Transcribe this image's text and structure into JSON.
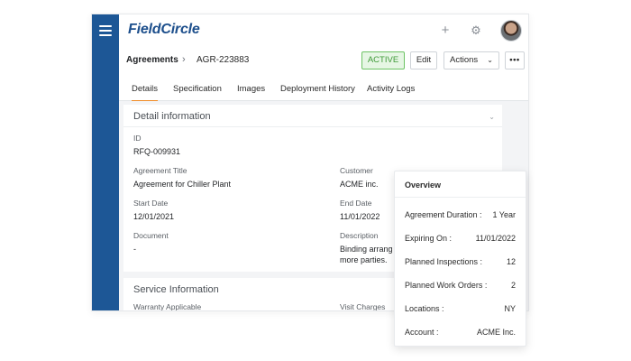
{
  "app": {
    "logo": "FieldCircle"
  },
  "header": {
    "add_icon": "+",
    "settings_icon": "⚙"
  },
  "breadcrumb": {
    "root": "Agreements",
    "separator": "›",
    "current": "AGR-223883"
  },
  "actions": {
    "status": "ACTIVE",
    "edit": "Edit",
    "actions": "Actions",
    "actions_chevron": "⌄",
    "more": "•••"
  },
  "tabs": [
    "Details",
    "Specification",
    "Images",
    "Deployment History",
    "Activity Logs"
  ],
  "detail": {
    "title": "Detail information",
    "collapse_icon": "⌄",
    "fields": {
      "id_label": "ID",
      "id_value": "RFQ-009931",
      "agreement_title_label": "Agreement Title",
      "agreement_title_value": "Agreement for Chiller Plant",
      "customer_label": "Customer",
      "customer_value": "ACME inc.",
      "start_date_label": "Start Date",
      "start_date_value": "12/01/2021",
      "end_date_label": "End Date",
      "end_date_value": "11/01/2022",
      "document_label": "Document",
      "document_value": "-",
      "description_label": "Description",
      "description_line1": "Binding arrang",
      "description_line2": "more parties."
    }
  },
  "service": {
    "title": "Service Information",
    "warranty_label": "Warranty Applicable",
    "visit_charges_label": "Visit Charges"
  },
  "overview": {
    "title": "Overview",
    "rows": [
      {
        "label": "Agreement Duration :",
        "value": "1 Year"
      },
      {
        "label": "Expiring On :",
        "value": "11/01/2022"
      },
      {
        "label": "Planned Inspections :",
        "value": "12"
      },
      {
        "label": "Planned Work Orders :",
        "value": "2"
      },
      {
        "label": "Locations :",
        "value": "NY"
      },
      {
        "label": "Account :",
        "value": "ACME Inc."
      }
    ]
  },
  "colors": {
    "rail": "#1d5796",
    "accent_tab": "#f08a24",
    "active_badge_bg": "#e6f6e4",
    "active_badge_text": "#3f9a38"
  }
}
